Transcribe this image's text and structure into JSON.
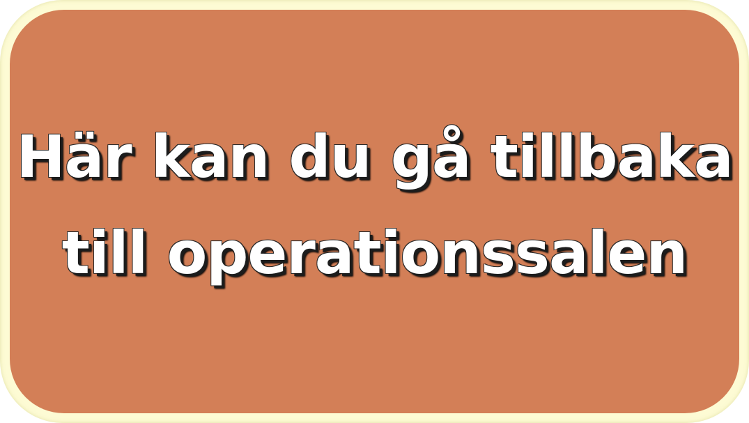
{
  "button": {
    "line1": "Här kan du gå tillbaka",
    "line2": "till operationssalen"
  },
  "colors": {
    "frame": "#fdfbd4",
    "button_fill": "#d37f57",
    "text": "#ffffff",
    "text_shadow": "#000000"
  }
}
